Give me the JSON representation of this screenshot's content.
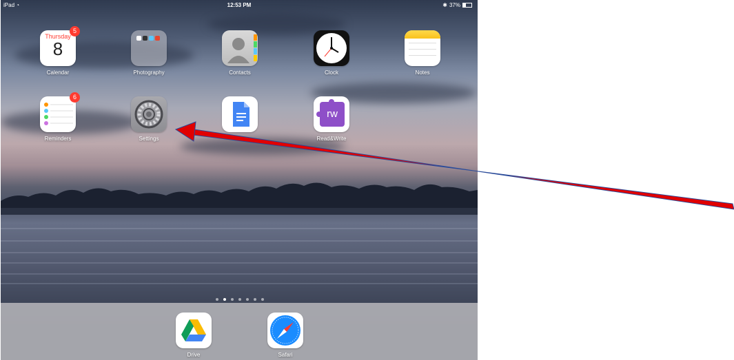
{
  "status": {
    "carrier": "iPad",
    "time": "12:53 PM",
    "battery_text": "37%",
    "battery_level": 0.37
  },
  "apps": [
    {
      "name": "Calendar",
      "day": "Thursday",
      "date": "8",
      "badge": "5"
    },
    {
      "name": "Photography"
    },
    {
      "name": "Contacts"
    },
    {
      "name": "Clock"
    },
    {
      "name": "Notes"
    },
    {
      "name": "Reminders",
      "badge": "6"
    },
    {
      "name": "Settings"
    },
    {
      "name": ""
    },
    {
      "name": "Read&Write",
      "icon_text": "rw"
    }
  ],
  "page_dots": {
    "count": 7,
    "active_index": 1
  },
  "dock": [
    {
      "name": "Drive"
    },
    {
      "name": "Safari"
    }
  ],
  "colors": {
    "arrow": "#e00000",
    "badge": "#ff3b30",
    "readwrite": "#8e4fc8",
    "docs": "#4285f4"
  },
  "icons": {
    "calendar": "calendar-icon",
    "photography": "folder-icon",
    "contacts": "contacts-icon",
    "clock": "clock-icon",
    "notes": "notes-icon",
    "reminders": "reminders-icon",
    "settings": "gear-icon",
    "docs": "google-docs-icon",
    "readwrite": "readwrite-icon",
    "drive": "google-drive-icon",
    "safari": "compass-icon"
  }
}
